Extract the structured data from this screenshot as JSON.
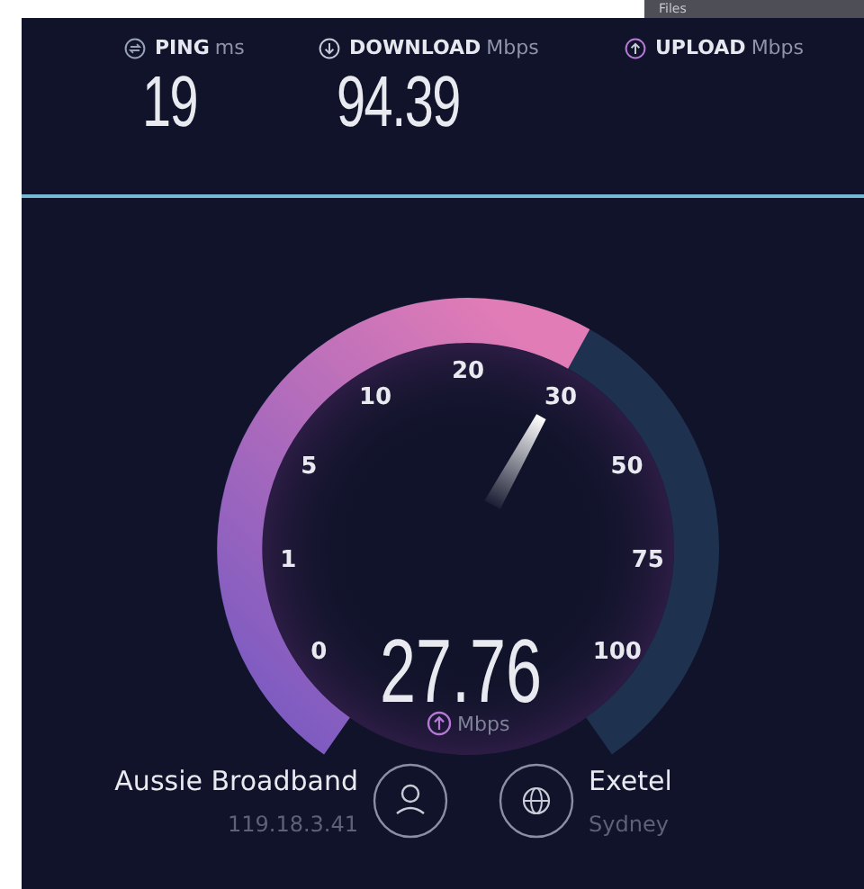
{
  "files_panel": {
    "label": "Files"
  },
  "metrics": [
    {
      "kind": "ping",
      "label": "PING",
      "unit": "ms",
      "value": "19"
    },
    {
      "kind": "download",
      "label": "DOWNLOAD",
      "unit": "Mbps",
      "value": "94.39"
    },
    {
      "kind": "upload",
      "label": "UPLOAD",
      "unit": "Mbps"
    }
  ],
  "gauge": {
    "scale": [
      "0",
      "1",
      "5",
      "10",
      "20",
      "30",
      "50",
      "75",
      "100"
    ],
    "level": 0.6,
    "reading": "27.76",
    "unit": "Mbps"
  },
  "isp": {
    "name": "Aussie Broadband",
    "ip": "119.18.3.41"
  },
  "server": {
    "name": "Exetel",
    "location": "Sydney"
  }
}
